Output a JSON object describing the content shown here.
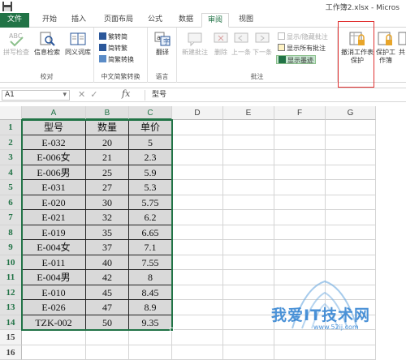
{
  "window": {
    "title": "工作簿2.xlsx - Micros"
  },
  "tabs": [
    {
      "label": "文件"
    },
    {
      "label": "开始"
    },
    {
      "label": "插入"
    },
    {
      "label": "页面布局"
    },
    {
      "label": "公式"
    },
    {
      "label": "数据"
    },
    {
      "label": "审阅"
    },
    {
      "label": "视图"
    }
  ],
  "ribbon": {
    "proofing": {
      "label": "校对",
      "spell": "拼写检查",
      "research": "信息检索",
      "thesaurus": "同义词库"
    },
    "chinese": {
      "label": "中文简繁转换",
      "to_simp": "繁转简",
      "to_trad": "简转繁",
      "convert": "简繁转换"
    },
    "language": {
      "label": "语言",
      "translate": "翻译"
    },
    "comments": {
      "label": "批注",
      "new": "新建批注",
      "delete": "删除",
      "prev": "上一条",
      "next": "下一条",
      "show_hide": "显示/隐藏批注",
      "show_all": "显示所有批注",
      "show_ink": "显示墨迹"
    },
    "changes": {
      "unprotect": "撤消工作表保护",
      "protect_wb": "保护工作簿",
      "share": "共"
    }
  },
  "formula_bar": {
    "namebox": "A1",
    "fx": "fx",
    "content": "型号"
  },
  "sheet": {
    "columns": [
      "A",
      "B",
      "C",
      "D",
      "E",
      "F",
      "G"
    ],
    "rows": [
      "1",
      "2",
      "3",
      "4",
      "5",
      "6",
      "7",
      "8",
      "9",
      "10",
      "11",
      "12",
      "13",
      "14",
      "15",
      "16"
    ],
    "headers": [
      "型号",
      "数量",
      "单价"
    ],
    "data": [
      [
        "E-032",
        "20",
        "5"
      ],
      [
        "E-006女",
        "21",
        "2.3"
      ],
      [
        "E-006男",
        "25",
        "5.9"
      ],
      [
        "E-031",
        "27",
        "5.3"
      ],
      [
        "E-020",
        "30",
        "5.75"
      ],
      [
        "E-021",
        "32",
        "6.2"
      ],
      [
        "E-019",
        "35",
        "6.65"
      ],
      [
        "E-004女",
        "37",
        "7.1"
      ],
      [
        "E-011",
        "40",
        "7.55"
      ],
      [
        "E-004男",
        "42",
        "8"
      ],
      [
        "E-010",
        "45",
        "8.45"
      ],
      [
        "E-026",
        "47",
        "8.9"
      ],
      [
        "TZK-002",
        "50",
        "9.35"
      ]
    ]
  },
  "watermark": {
    "text": "我爱IT技术网",
    "url": "www.52ij.com"
  },
  "colors": {
    "accent": "#217346",
    "highlight": "#e03030",
    "watermark": "#2c7fd1"
  }
}
